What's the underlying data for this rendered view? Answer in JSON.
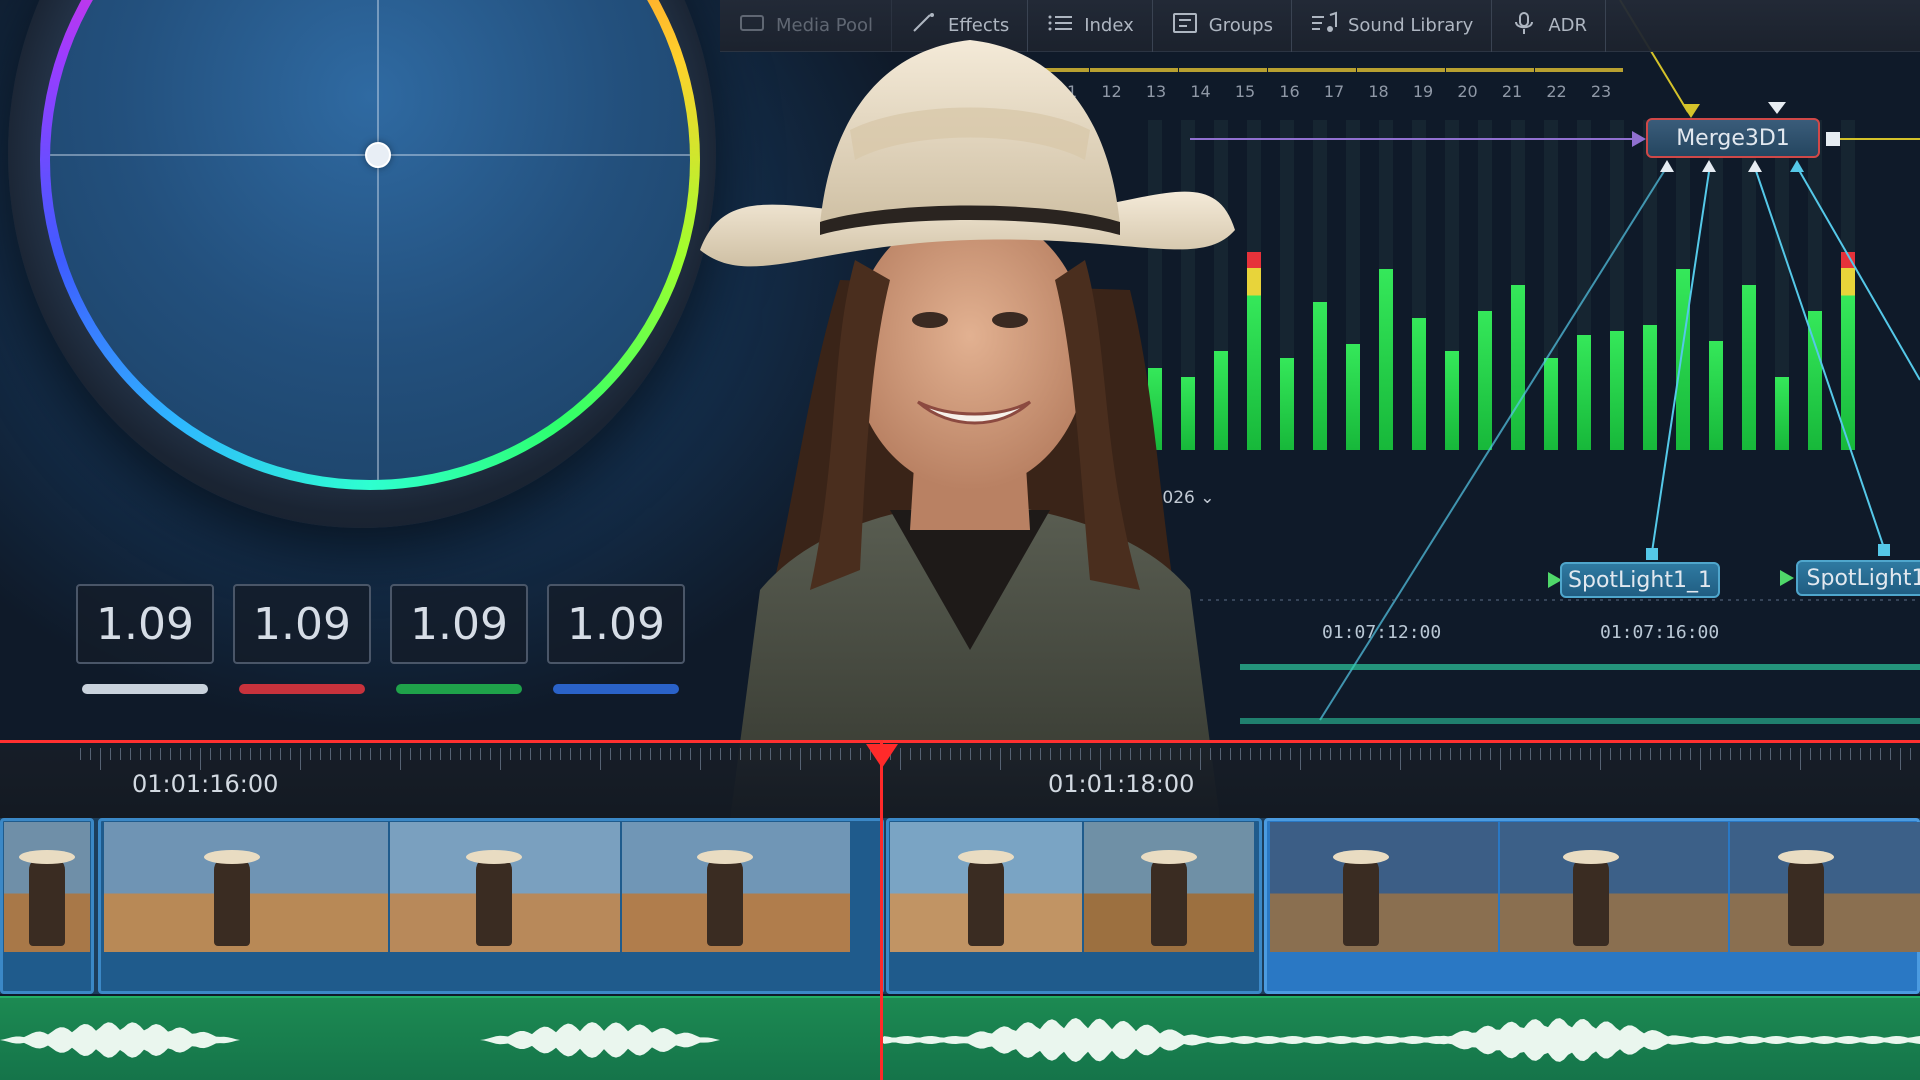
{
  "toolbar": {
    "items": [
      {
        "label": "Media Pool",
        "icon": "media-pool-icon"
      },
      {
        "label": "Effects",
        "icon": "effects-wand-icon"
      },
      {
        "label": "Index",
        "icon": "index-list-icon"
      },
      {
        "label": "Groups",
        "icon": "groups-icon"
      },
      {
        "label": "Sound Library",
        "icon": "sound-library-icon"
      },
      {
        "label": "ADR",
        "icon": "microphone-icon"
      }
    ]
  },
  "color_wheel": {
    "values": [
      "1.09",
      "1.09",
      "1.09",
      "1.09"
    ],
    "bar_colors": [
      "#c9d2dc",
      "#c8323c",
      "#1fa24a",
      "#2a62c8"
    ]
  },
  "meters": {
    "channels": [
      "11",
      "12",
      "13",
      "14",
      "15",
      "16",
      "17",
      "18",
      "19",
      "20",
      "21",
      "22",
      "23"
    ],
    "tick_color": "#b8a030"
  },
  "nodes": {
    "merge": "Merge3D1",
    "spot1": "SpotLight1_1",
    "spot2": "SpotLight1"
  },
  "mid_timeline": {
    "edit_label": "dit 2026",
    "tc1": "01:07:12:00",
    "tc2": "01:07:16:00"
  },
  "timeline": {
    "tc_left": "01:01:16:00",
    "tc_right": "01:01:18:00",
    "playhead_color": "#ff2a2a"
  }
}
